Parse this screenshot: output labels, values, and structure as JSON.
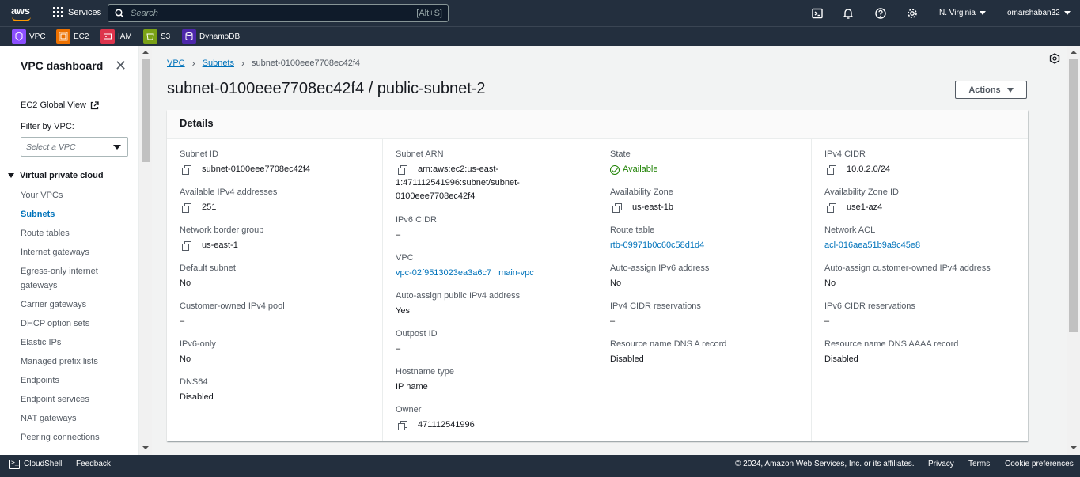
{
  "topnav": {
    "logo_text": "aws",
    "services_label": "Services",
    "search_placeholder": "Search",
    "search_shortcut": "[Alt+S]",
    "icons": [
      "cloudshell-icon",
      "bell-icon",
      "help-icon",
      "gear-icon"
    ],
    "region": "N. Virginia",
    "user": "omarshaban32"
  },
  "favorites": [
    {
      "label": "VPC",
      "color": "#8c4fff"
    },
    {
      "label": "EC2",
      "color": "#ed7100"
    },
    {
      "label": "IAM",
      "color": "#dd344c"
    },
    {
      "label": "S3",
      "color": "#7aa116"
    },
    {
      "label": "DynamoDB",
      "color": "#4d27aa"
    }
  ],
  "sidebar": {
    "title": "VPC dashboard",
    "ec2_global_view": "EC2 Global View",
    "filter_label": "Filter by VPC:",
    "filter_placeholder": "Select a VPC",
    "section": "Virtual private cloud",
    "items": [
      {
        "label": "Your VPCs"
      },
      {
        "label": "Subnets",
        "active": true
      },
      {
        "label": "Route tables"
      },
      {
        "label": "Internet gateways"
      },
      {
        "label": "Egress-only internet gateways"
      },
      {
        "label": "Carrier gateways"
      },
      {
        "label": "DHCP option sets"
      },
      {
        "label": "Elastic IPs"
      },
      {
        "label": "Managed prefix lists"
      },
      {
        "label": "Endpoints"
      },
      {
        "label": "Endpoint services"
      },
      {
        "label": "NAT gateways"
      },
      {
        "label": "Peering connections"
      }
    ]
  },
  "breadcrumb": {
    "vpc": "VPC",
    "subnets": "Subnets",
    "current": "subnet-0100eee7708ec42f4"
  },
  "page": {
    "title": "subnet-0100eee7708ec42f4 / public-subnet-2",
    "actions_label": "Actions"
  },
  "details": {
    "heading": "Details",
    "col1": {
      "subnet_id": {
        "label": "Subnet ID",
        "value": "subnet-0100eee7708ec42f4"
      },
      "available_ipv4": {
        "label": "Available IPv4 addresses",
        "value": "251"
      },
      "network_border_group": {
        "label": "Network border group",
        "value": "us-east-1"
      },
      "default_subnet": {
        "label": "Default subnet",
        "value": "No"
      },
      "customer_owned_pool": {
        "label": "Customer-owned IPv4 pool",
        "value": "–"
      },
      "ipv6_only": {
        "label": "IPv6-only",
        "value": "No"
      },
      "dns64": {
        "label": "DNS64",
        "value": "Disabled"
      }
    },
    "col2": {
      "subnet_arn": {
        "label": "Subnet ARN",
        "line1": "arn:aws:ec2:us-east-",
        "line2": "1:471112541996:subnet/subnet-",
        "line3": "0100eee7708ec42f4"
      },
      "ipv6_cidr": {
        "label": "IPv6 CIDR",
        "value": "–"
      },
      "vpc": {
        "label": "VPC",
        "value": "vpc-02f9513023ea3a6c7 | main-vpc"
      },
      "auto_assign_public_ipv4": {
        "label": "Auto-assign public IPv4 address",
        "value": "Yes"
      },
      "outpost_id": {
        "label": "Outpost ID",
        "value": "–"
      },
      "hostname_type": {
        "label": "Hostname type",
        "value": "IP name"
      },
      "owner": {
        "label": "Owner",
        "value": "471112541996"
      }
    },
    "col3": {
      "state": {
        "label": "State",
        "value": "Available",
        "color": "#1d8102"
      },
      "availability_zone": {
        "label": "Availability Zone",
        "value": "us-east-1b"
      },
      "route_table": {
        "label": "Route table",
        "value": "rtb-09971b0c60c58d1d4"
      },
      "auto_assign_ipv6": {
        "label": "Auto-assign IPv6 address",
        "value": "No"
      },
      "ipv4_cidr_reservations": {
        "label": "IPv4 CIDR reservations",
        "value": "–"
      },
      "dns_a_record": {
        "label": "Resource name DNS A record",
        "value": "Disabled"
      }
    },
    "col4": {
      "ipv4_cidr": {
        "label": "IPv4 CIDR",
        "value": "10.0.2.0/24"
      },
      "availability_zone_id": {
        "label": "Availability Zone ID",
        "value": "use1-az4"
      },
      "network_acl": {
        "label": "Network ACL",
        "value": "acl-016aea51b9a9c45e8"
      },
      "auto_assign_customer_owned": {
        "label": "Auto-assign customer-owned IPv4 address",
        "value": "No"
      },
      "ipv6_cidr_reservations": {
        "label": "IPv6 CIDR reservations",
        "value": "–"
      },
      "dns_aaaa_record": {
        "label": "Resource name DNS AAAA record",
        "value": "Disabled"
      }
    }
  },
  "footer": {
    "cloudshell": "CloudShell",
    "feedback": "Feedback",
    "copyright": "© 2024, Amazon Web Services, Inc. or its affiliates.",
    "privacy": "Privacy",
    "terms": "Terms",
    "cookies": "Cookie preferences"
  },
  "colors": {
    "nav_bg": "#232f3e",
    "link": "#0073bb",
    "success": "#1d8102",
    "accent": "#ff9900"
  }
}
